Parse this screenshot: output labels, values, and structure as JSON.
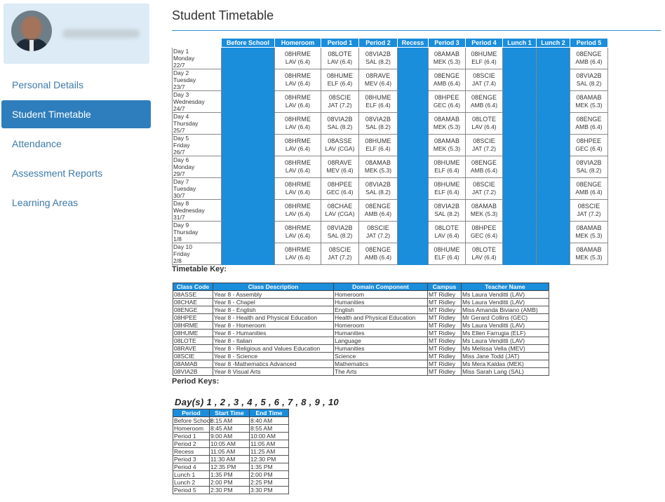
{
  "sidebar": {
    "nav": [
      {
        "label": "Personal Details",
        "active": false
      },
      {
        "label": "Student Timetable",
        "active": true
      },
      {
        "label": "Attendance",
        "active": false
      },
      {
        "label": "Assessment Reports",
        "active": false
      },
      {
        "label": "Learning Areas",
        "active": false
      }
    ]
  },
  "page": {
    "title": "Student Timetable"
  },
  "timetable": {
    "headers": [
      "",
      "Before School",
      "Homeroom",
      "Period 1",
      "Period 2",
      "Recess",
      "Period 3",
      "Period 4",
      "Lunch 1",
      "Lunch 2",
      "Period 5"
    ],
    "blue_columns": [
      1,
      5,
      8,
      9
    ],
    "rows": [
      {
        "day": [
          "Day 1",
          "Monday",
          "22/7"
        ],
        "cells": [
          "",
          [
            "08HRME",
            "LAV (6.4)"
          ],
          [
            "08LOTE",
            "LAV (6.4)"
          ],
          [
            "08VIA2B",
            "SAL (8.2)"
          ],
          "",
          [
            "08AMAB",
            "MEK (5.3)"
          ],
          [
            "08HUME",
            "ELF (6.4)"
          ],
          "",
          "",
          [
            "08ENGE",
            "AMB (6.4)"
          ]
        ]
      },
      {
        "day": [
          "Day 2",
          "Tuesday",
          "23/7"
        ],
        "cells": [
          "",
          [
            "08HRME",
            "LAV (6.4)"
          ],
          [
            "08HUME",
            "ELF (6.4)"
          ],
          [
            "08RAVE",
            "MEV (6.4)"
          ],
          "",
          [
            "08ENGE",
            "AMB (6.4)"
          ],
          [
            "08SCIE",
            "JAT (7.4)"
          ],
          "",
          "",
          [
            "08VIA2B",
            "SAL (8.2)"
          ]
        ]
      },
      {
        "day": [
          "Day 3",
          "Wednesday",
          "24/7"
        ],
        "cells": [
          "",
          [
            "08HRME",
            "LAV (6.4)"
          ],
          [
            "08SCIE",
            "JAT (7.2)"
          ],
          [
            "08HUME",
            "ELF (6.4)"
          ],
          "",
          [
            "08HPEE",
            "GEC (6.4)"
          ],
          [
            "08ENGE",
            "AMB (6.4)"
          ],
          "",
          "",
          [
            "08AMAB",
            "MEK (5.3)"
          ]
        ]
      },
      {
        "day": [
          "Day 4",
          "Thursday",
          "25/7"
        ],
        "cells": [
          "",
          [
            "08HRME",
            "LAV (6.4)"
          ],
          [
            "08VIA2B",
            "SAL (8.2)"
          ],
          [
            "08VIA2B",
            "SAL (8.2)"
          ],
          "",
          [
            "08AMAB",
            "MEK (5.3)"
          ],
          [
            "08LOTE",
            "LAV (6.4)"
          ],
          "",
          "",
          [
            "08ENGE",
            "AMB (6.4)"
          ]
        ]
      },
      {
        "day": [
          "Day 5",
          "Friday",
          "26/7"
        ],
        "cells": [
          "",
          [
            "08HRME",
            "LAV (6.4)"
          ],
          [
            "08ASSE",
            "LAV (CGA)"
          ],
          [
            "08HUME",
            "ELF (6.4)"
          ],
          "",
          [
            "08AMAB",
            "MEK (5.3)"
          ],
          [
            "08SCIE",
            "JAT (7.2)"
          ],
          "",
          "",
          [
            "08HPEE",
            "GEC (6.4)"
          ]
        ]
      },
      {
        "day": [
          "Day 6",
          "Monday",
          "29/7"
        ],
        "cells": [
          "",
          [
            "08HRME",
            "LAV (6.4)"
          ],
          [
            "08RAVE",
            "MEV (6.4)"
          ],
          [
            "08AMAB",
            "MEK (5.3)"
          ],
          "",
          [
            "08HUME",
            "ELF (6.4)"
          ],
          [
            "08ENGE",
            "AMB (6.4)"
          ],
          "",
          "",
          [
            "08VIA2B",
            "SAL (8.2)"
          ]
        ]
      },
      {
        "day": [
          "Day 7",
          "Tuesday",
          "30/7"
        ],
        "cells": [
          "",
          [
            "08HRME",
            "LAV (6.4)"
          ],
          [
            "08HPEE",
            "GEC (6.4)"
          ],
          [
            "08VIA2B",
            "SAL (8.2)"
          ],
          "",
          [
            "08HUME",
            "ELF (6.4)"
          ],
          [
            "08SCIE",
            "JAT (7.2)"
          ],
          "",
          "",
          [
            "08ENGE",
            "AMB (6.4)"
          ]
        ]
      },
      {
        "day": [
          "Day 8",
          "Wednesday",
          "31/7"
        ],
        "cells": [
          "",
          [
            "08HRME",
            "LAV (6.4)"
          ],
          [
            "08CHAE",
            "LAV (CGA)"
          ],
          [
            "08ENGE",
            "AMB (6.4)"
          ],
          "",
          [
            "08VIA2B",
            "SAL (8.2)"
          ],
          [
            "08AMAB",
            "MEK (5.3)"
          ],
          "",
          "",
          [
            "08SCIE",
            "JAT (7.2)"
          ]
        ]
      },
      {
        "day": [
          "Day 9",
          "Thursday",
          "1/8"
        ],
        "cells": [
          "",
          [
            "08HRME",
            "LAV (6.4)"
          ],
          [
            "08VIA2B",
            "SAL (8.2)"
          ],
          [
            "08SCIE",
            "JAT (7.2)"
          ],
          "",
          [
            "08LOTE",
            "LAV (6.4)"
          ],
          [
            "08HPEE",
            "GEC (6.4)"
          ],
          "",
          "",
          [
            "08AMAB",
            "MEK (5.3)"
          ]
        ]
      },
      {
        "day": [
          "Day 10",
          "Friday",
          "2/8"
        ],
        "cells": [
          "",
          [
            "08HRME",
            "LAV (6.4)"
          ],
          [
            "08SCIE",
            "JAT (7.2)"
          ],
          [
            "08ENGE",
            "AMB (6.4)"
          ],
          "",
          [
            "08HUME",
            "ELF (6.4)"
          ],
          [
            "08LOTE",
            "LAV (6.4)"
          ],
          "",
          "",
          [
            "08AMAB",
            "MEK (5.3)"
          ]
        ]
      }
    ]
  },
  "timetable_key": {
    "label": "Timetable Key:",
    "headers": [
      "Class Code",
      "Class Description",
      "Domain Component",
      "Campus",
      "Teacher Name"
    ],
    "rows": [
      [
        "08ASSE",
        "Year 8 - Assembly",
        "Homeroom",
        "MT Ridley",
        "Ms Laura Venditti (LAV)"
      ],
      [
        "08CHAE",
        "Year 8 - Chapel",
        "Humanities",
        "MT Ridley",
        "Ms Laura Venditti (LAV)"
      ],
      [
        "08ENGE",
        "Year 8 - English",
        "English",
        "MT Ridley",
        "Miss Amanda Biviano (AMB)"
      ],
      [
        "08HPEE",
        "Year 8 - Health and Physical Education",
        "Health and Physical Education",
        "MT Ridley",
        "Mr Gerard Collins (GEC)"
      ],
      [
        "08HRME",
        "Year 8 - Homeroom",
        "Homeroom",
        "MT Ridley",
        "Ms Laura Venditti (LAV)"
      ],
      [
        "08HUME",
        "Year 8 - Humanities",
        "Humanities",
        "MT Ridley",
        "Ms Ellen Farrugia (ELF)"
      ],
      [
        "08LOTE",
        "Year 8 - Italian",
        "Language",
        "MT Ridley",
        "Ms Laura Venditti (LAV)"
      ],
      [
        "08RAVE",
        "Year 8 - Religious and Values Education",
        "Humanities",
        "MT Ridley",
        "Ms Melissa Vella (MEV)"
      ],
      [
        "08SCIE",
        "Year 8 - Science",
        "Science",
        "MT Ridley",
        "Miss Jane Todd (JAT)"
      ],
      [
        "08AMAB",
        "Year 8 -Mathematics Advanced",
        "Mathematics",
        "MT Ridley",
        "Ms Mera Kaldas (MEK)"
      ],
      [
        "08VIA2B",
        "Year 8 Visual Arts",
        "The Arts",
        "MT Ridley",
        "Miss Sarah Lang (SAL)"
      ]
    ]
  },
  "period_keys": {
    "label": "Period Keys:",
    "days_line": "Day(s)  1 , 2 , 3 , 4 , 5 , 6 , 7 , 8 , 9 , 10",
    "headers": [
      "Period",
      "Start Time",
      "End Time"
    ],
    "rows": [
      [
        "Before School",
        "8:15 AM",
        "8:40 AM"
      ],
      [
        "Homeroom",
        "8:45 AM",
        "8:55 AM"
      ],
      [
        "Period 1",
        "9:00 AM",
        "10:00 AM"
      ],
      [
        "Period 2",
        "10:05 AM",
        "11:05 AM"
      ],
      [
        "Recess",
        "11:05 AM",
        "11:25 AM"
      ],
      [
        "Period 3",
        "11:30 AM",
        "12:30 PM"
      ],
      [
        "Period 4",
        "12:35 PM",
        "1:35 PM"
      ],
      [
        "Lunch 1",
        "1:35 PM",
        "2:00 PM"
      ],
      [
        "Lunch 2",
        "2:00 PM",
        "2:25 PM"
      ],
      [
        "Period 5",
        "2:30 PM",
        "3:30 PM"
      ]
    ]
  },
  "colors": {
    "accent": "#1a8ddb",
    "nav_active": "#2e7dbc",
    "nav_link": "#3d7aa8",
    "profile_bg": "#dcebf5"
  }
}
